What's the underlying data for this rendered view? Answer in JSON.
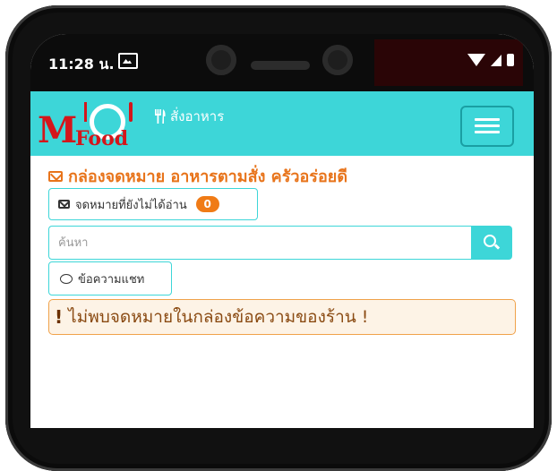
{
  "status_bar": {
    "time": "11:28 น."
  },
  "navbar": {
    "logo_m": "M",
    "logo_food": "Food",
    "brand_text": "สั่งอาหาร",
    "brand_icon": "utensils-icon",
    "menu_icon": "hamburger-icon"
  },
  "heading": {
    "text": "กล่องจดหมาย อาหารตามสั่ง ครัวอร่อยดี",
    "icon": "envelope-icon"
  },
  "unread_button": {
    "label": "จดหมายที่ยังไม่ได้อ่าน",
    "count": "0"
  },
  "search": {
    "placeholder": "ค้นหา",
    "icon": "search-icon"
  },
  "chat_button": {
    "label": "ข้อความแชท",
    "icon": "chat-icon"
  },
  "alert": {
    "mark": "!",
    "text": "ไม่พบจดหมายในกล่องข้อความของร้าน !"
  },
  "colors": {
    "accent": "#3dd6d8",
    "heading": "#e8741b",
    "badge": "#f07b16",
    "alert_bg": "#fdf3e6",
    "logo": "#d4161b"
  }
}
